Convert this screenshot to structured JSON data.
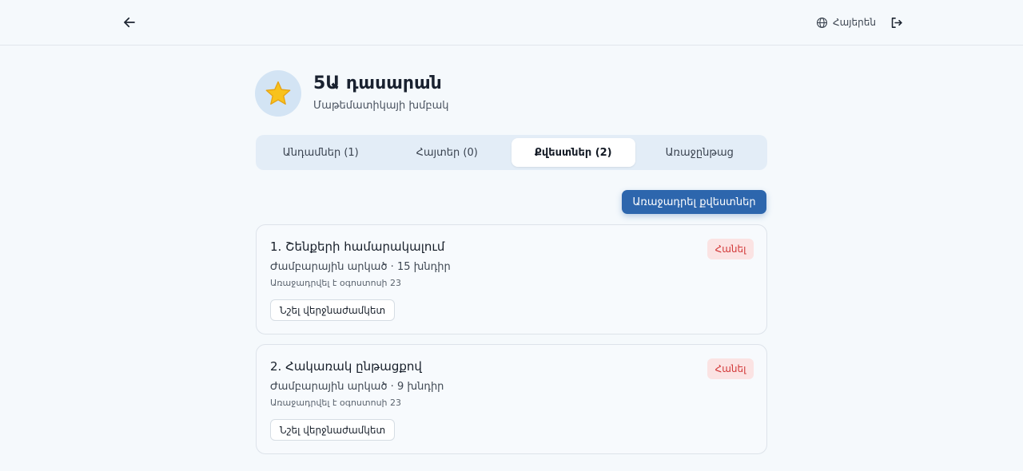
{
  "topbar": {
    "back_icon": "arrow-left-icon",
    "language_icon": "globe-icon",
    "language_label": "Հայերեն",
    "logout_icon": "logout-icon"
  },
  "group": {
    "emoji": "⭐",
    "title": "5Ա դասարան",
    "subtitle": "Մաթեմատիկայի խմբակ"
  },
  "tabs": [
    {
      "label": "Անդամներ (1)",
      "active": false
    },
    {
      "label": "Հայտեր (0)",
      "active": false
    },
    {
      "label": "Քվեստներ (2)",
      "active": true
    },
    {
      "label": "Առաջընթաց",
      "active": false
    }
  ],
  "actions": {
    "assign_quests_label": "Առաջադրել քվեստներ"
  },
  "quizzes": [
    {
      "title": "1. Շենքերի համարակալում",
      "meta": "Ժամբարային արկած · 15 խնդիր",
      "assigned": "Առաջադրվել է օգոստոսի 23",
      "results_label": "Նշել վերջնաժամկետ",
      "remove_label": "Հանել"
    },
    {
      "title": "2. Հակառակ ընթացքով",
      "meta": "Ժամբարային արկած · 9 խնդիր",
      "assigned": "Առաջադրվել է օգոստոսի 23",
      "results_label": "Նշել վերջնաժամկետ",
      "remove_label": "Հանել"
    }
  ],
  "colors": {
    "accent": "#2d66ad",
    "danger": "#d23737",
    "danger_bg": "#fbe3e3",
    "avatar_bg": "#d3e4f4",
    "tabs_bg": "#e3edf7"
  }
}
